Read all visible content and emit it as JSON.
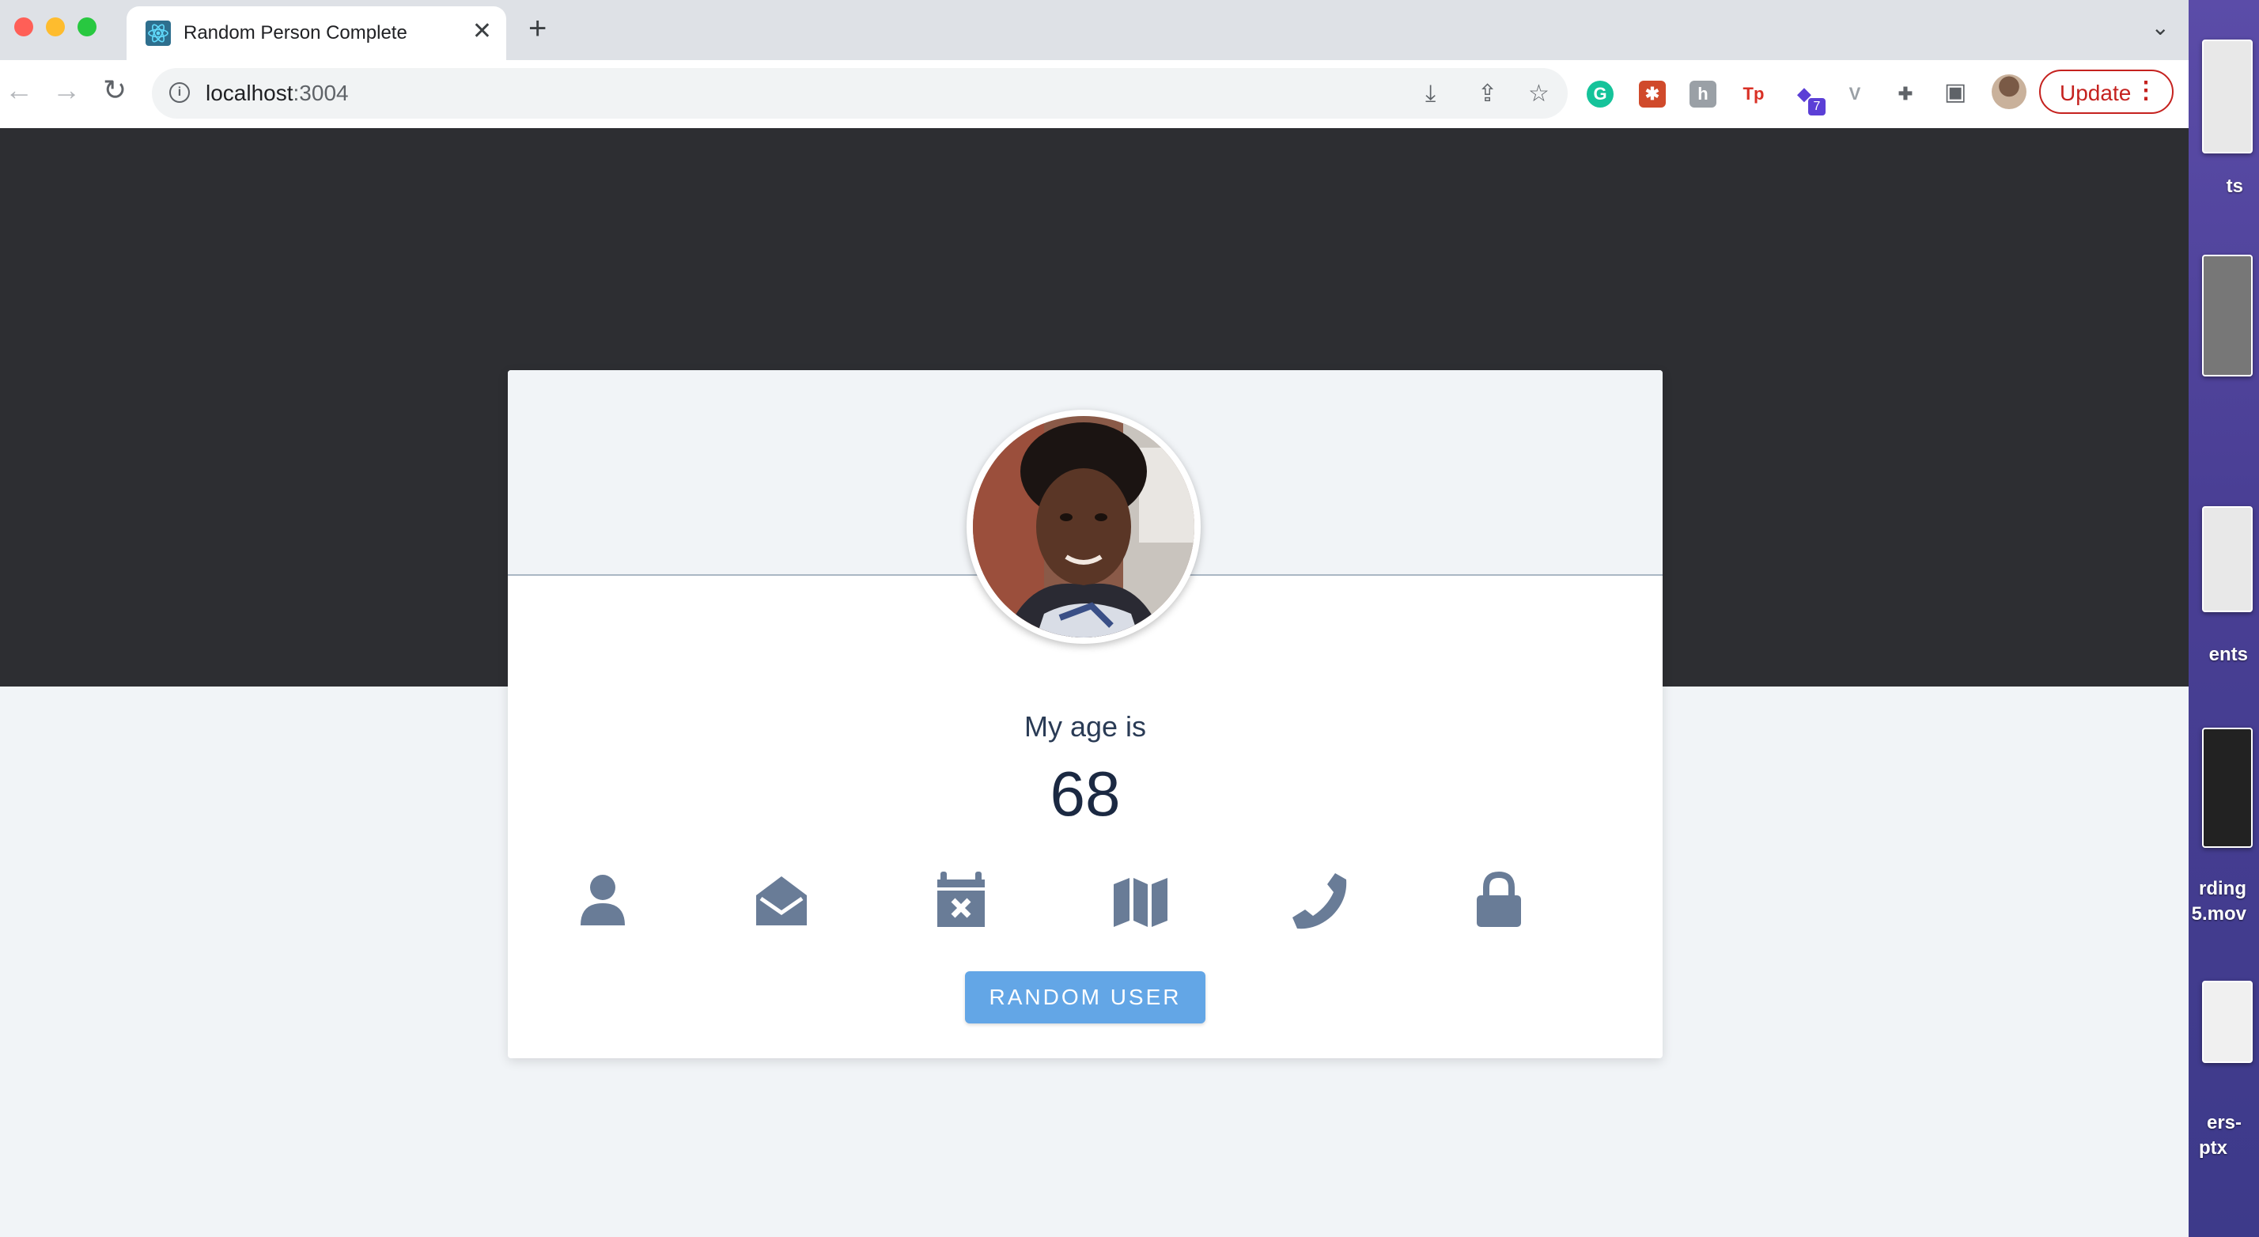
{
  "browser": {
    "tab": {
      "title": "Random Person Complete"
    },
    "address": {
      "host": "localhost",
      "port": ":3004"
    },
    "update_label": "Update",
    "extension_badge": "7"
  },
  "desktop": {
    "items": [
      "ts",
      "ents",
      "rding",
      "5.mov",
      "ers-",
      "ptx"
    ]
  },
  "card": {
    "age_title": "My age is",
    "age_value": "68",
    "button_label": "RANDOM USER",
    "icons": [
      "user-icon",
      "envelope-open-icon",
      "calendar-x-icon",
      "map-icon",
      "phone-icon",
      "lock-icon"
    ]
  },
  "colors": {
    "hero_bg": "#2d2e32",
    "page_bg": "#f1f4f7",
    "icon": "#697c97",
    "button": "#63a6e6",
    "update": "#c5221f"
  }
}
